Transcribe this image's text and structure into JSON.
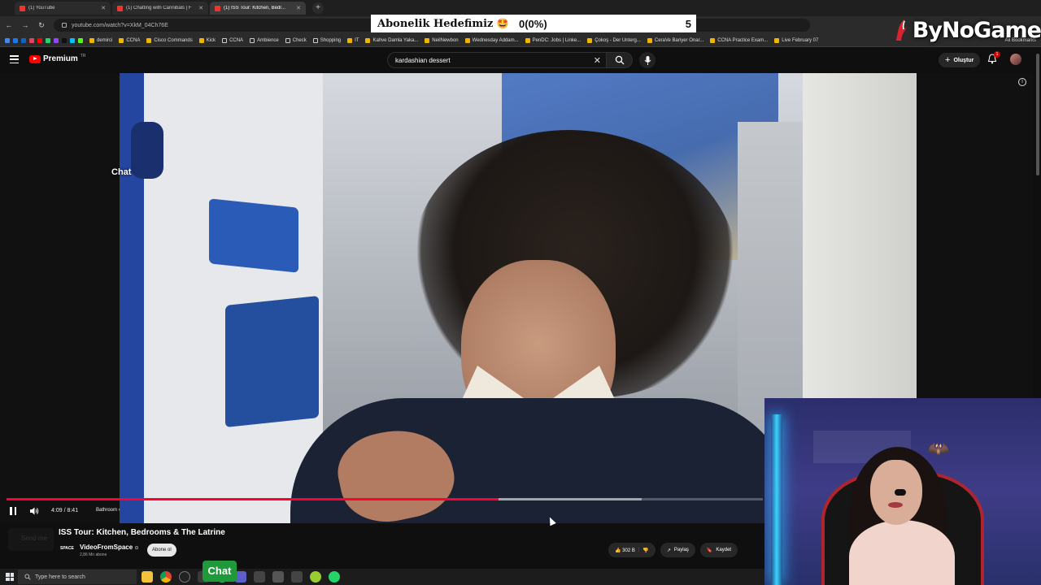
{
  "browser": {
    "tabs": [
      {
        "title": "(1) YouTube",
        "active": false
      },
      {
        "title": "(1) Chatting with Cannibals | F",
        "active": false
      },
      {
        "title": "(1) ISS Tour: Kitchen, Bedr...",
        "active": true
      }
    ],
    "url": "youtube.com/watch?v=XkM_04Ch76E",
    "bookmarks": [
      "demirci",
      "CCNA",
      "Cisco Commands",
      "Kick",
      "CCNA",
      "Ambience",
      "Check",
      "Shopping",
      "IT",
      "Kahve Damla Yaka...",
      "NeilNewbon",
      "Wednesday Addam...",
      "PenDC: Jobs | Linke...",
      "Çokoş - Der Unterg...",
      "CeraVe Bariyer Onar...",
      "CCNA Practice Exam...",
      "Live February 07"
    ],
    "all_bookmarks": "All Bookmarks"
  },
  "overlay": {
    "goal_label": "Abonelik Hedefimiz",
    "goal_emoji": "🤩",
    "goal_progress": "0(0%)",
    "goal_target": "5",
    "brand_text": "ByNoGame"
  },
  "youtube": {
    "logo_word": "Premium",
    "logo_region": "TR",
    "search_value": "kardashian dessert",
    "create_label": "Oluştur",
    "notif_count": "1"
  },
  "video": {
    "chat_overlay": "Chat",
    "time": "4:09 / 8:41",
    "chapter": "Bathroom",
    "played_fraction": 0.65,
    "loaded_fraction": 0.84,
    "title": "ISS Tour: Kitchen, Bedrooms & The Latrine",
    "channel_logo": "SPACE",
    "channel": "VideoFromSpace",
    "channel_verified": "⊙",
    "subscribers": "2,86 Mn abone",
    "subscribe_label": "Abone ol",
    "ghost_text": "Send me",
    "likes": "302 B",
    "share_label": "Paylaş",
    "save_label": "Kaydet"
  },
  "taskbar": {
    "search_placeholder": "Type here to search",
    "chat_label": "Chat"
  },
  "colors": {
    "accent_red": "#ff0033",
    "chat_green": "#1e9a3a"
  }
}
